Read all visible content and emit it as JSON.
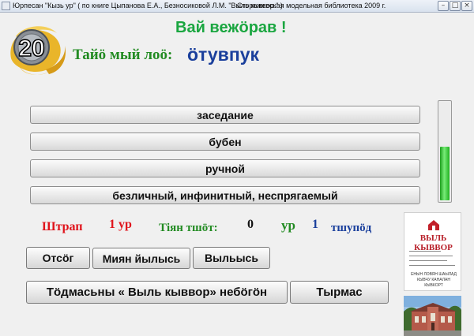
{
  "window": {
    "title": "Юрпесан \"Кызь ур\"  ( по книге Цыпанова Е.А., Безносиковой Л.М. \"Выль кывкор.\"   )",
    "library": "Сторожевская модельная библиотека 2009 г.",
    "minimize_glyph": "–",
    "maximize_glyph": "□",
    "close_glyph": "×"
  },
  "badge": {
    "number": "20"
  },
  "greeting": "Вай вежӧрав  !",
  "prompt": {
    "label": "Тайӧ мый лоӧ:",
    "word": "ӧтувпук"
  },
  "answers": [
    "заседание",
    "бубен",
    "ручной",
    "безличный, инфинитный, неспрягаемый"
  ],
  "progress": {
    "level": 0.55,
    "color": "#2fc12f"
  },
  "stats": {
    "penalty_label": "Штрап",
    "penalty_value": "1 ур",
    "score_label": "Тіян тшӧт:",
    "score_value": "0",
    "level_label": "ур",
    "level_value": "1",
    "level_unit": "тшупӧд"
  },
  "buttons": {
    "cancel": "Отсӧг",
    "mine": "Миян йылысь",
    "exit": "Выльысь",
    "dictionary": "Тӧдмасьны « Выль кыввор» небӧгӧн",
    "next": "Тырмас"
  },
  "book": {
    "title": "ВЫЛЬ КЫВВОР",
    "authors": "ЕНЫН ЛОВЯН ШАЫЛАД КЫВЧУ КАНАЛАН КЫВКОРТ"
  },
  "colors": {
    "green": "#228b22",
    "blue": "#1a3f9c",
    "red": "#e0141c",
    "greeting": "#1aa640"
  }
}
